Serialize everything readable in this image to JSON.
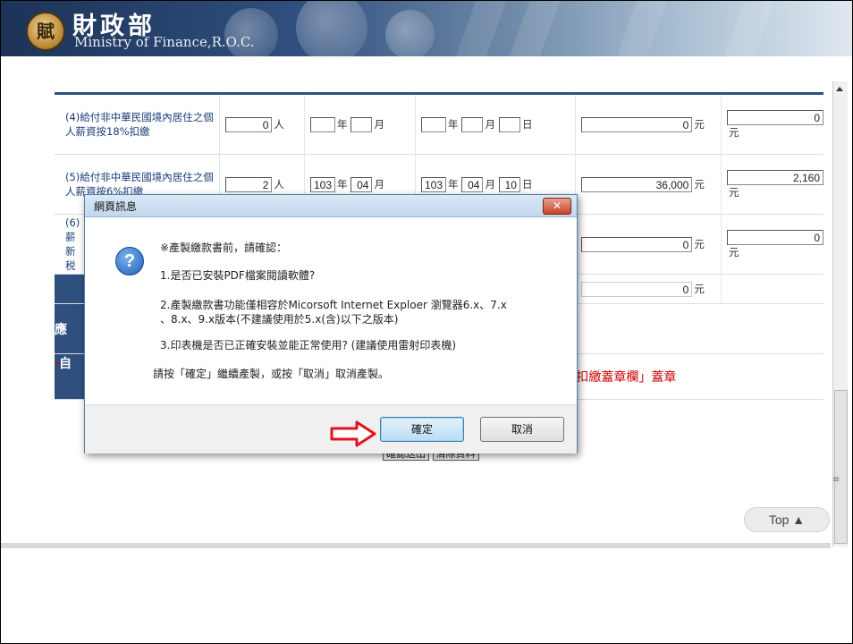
{
  "header": {
    "emblem_glyph": "賦",
    "ministry_cn": "財政部",
    "ministry_en": "Ministry of Finance,R.O.C."
  },
  "rows": [
    {
      "label": "(4)給付非中華民國境內居住之個人薪資按18%扣繳",
      "count": "0",
      "count_unit": "人",
      "year1": "",
      "month1": "",
      "unit_year": "年",
      "unit_month": "月",
      "year2": "",
      "month2": "",
      "day2": "",
      "unit_day": "日",
      "amount1": "0",
      "amount2": "0",
      "unit_yuan": "元"
    },
    {
      "label": "(5)給付非中華民國境內居住之個人薪資按6%扣繳",
      "count": "2",
      "count_unit": "人",
      "year1": "103",
      "month1": "04",
      "unit_year": "年",
      "unit_month": "月",
      "year2": "103",
      "month2": "04",
      "day2": "10",
      "unit_day": "日",
      "amount1": "36,000",
      "amount2": "2,160",
      "unit_yuan": "元"
    },
    {
      "label_prefix": "(6)",
      "label_lines": [
        "薪",
        "新",
        "税"
      ],
      "amount1": "0",
      "amount2": "0",
      "unit_yuan": "元"
    }
  ],
  "total_row": {
    "amount1": "0",
    "unit_yuan": "元"
  },
  "section_label": "應",
  "self_label": "自",
  "notice_text": "扣繳蓋章欄」蓋章",
  "under_buttons": [
    "確認送出",
    "清除資料"
  ],
  "top_button": "Top ▲",
  "dialog": {
    "title": "網頁訊息",
    "close_glyph": "✕",
    "icon_glyph": "?",
    "lines": [
      "※產製繳款書前，請確認：",
      "1.是否已安裝PDF檔案閱讀軟體?",
      "2.產製繳款書功能僅相容於Micorsoft Internet Exploer 瀏覽器6.x、7.x",
      "、8.x、9.x版本(不建議使用於5.x(含)以下之版本)",
      "3.印表機是否已正確安裝並能正常使用? (建議使用雷射印表機)",
      "請按「確定」繼續產製，或按「取消」取消產製。"
    ],
    "ok_label": "確定",
    "cancel_label": "取消"
  },
  "colors": {
    "navy": "#2f4f7e",
    "arrow": "#e0141e",
    "notice": "#cc0000"
  }
}
